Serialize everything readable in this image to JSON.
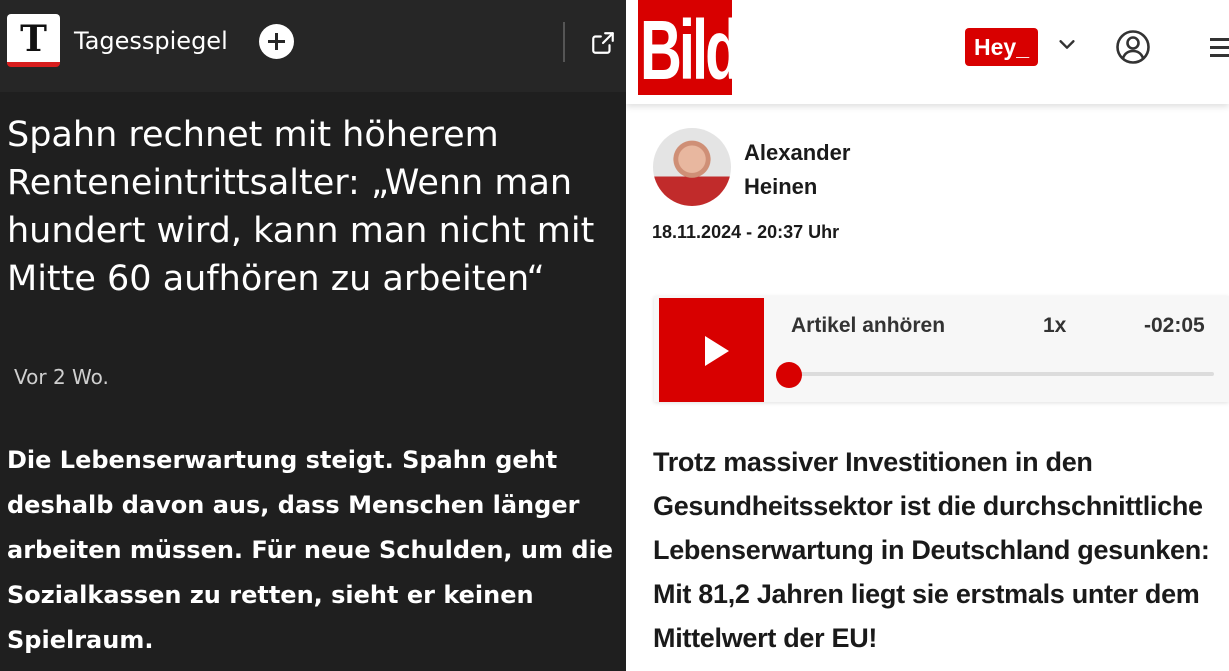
{
  "tagesspiegel": {
    "logo_letter": "T",
    "name": "Tagesspiegel",
    "title": "Spahn rechnet mit höherem Renteneintrittsalter: „Wenn man hundert wird, kann man nicht mit Mitte 60 aufhören zu arbeiten“",
    "time": "Vor 2 Wo.",
    "body": "Die Lebenserwartung steigt. Spahn geht deshalb davon aus, dass Menschen länger arbeiten müssen. Für neue Schulden, um die Sozialkassen zu retten, sieht er keinen Spielraum.",
    "icons": {
      "follow": "plus-icon",
      "share": "external-link-icon"
    }
  },
  "bild": {
    "logo": "Bild",
    "hey_label": "Hey_",
    "author_first": "Alexander",
    "author_last": "Heinen",
    "date": "18.11.2024 - 20:37 Uhr",
    "player": {
      "label": "Artikel anhören",
      "speed": "1x",
      "remaining": "-02:05",
      "progress_fraction": 0.0
    },
    "body": "Trotz massiver Investitionen in den Gesundheitssektor ist die durchschnittliche Lebenserwartung in Deutschland gesunken: Mit 81,2 Jahren liegt sie erstmals unter dem Mittelwert der EU!",
    "icons": {
      "dropdown": "chevron-down-icon",
      "account": "user-circle-icon",
      "menu": "hamburger-menu-icon"
    }
  },
  "colors": {
    "bild_red": "#d80000",
    "tagesspiegel_bg": "#1f1f1f",
    "tagesspiegel_red": "#d81e1e"
  }
}
